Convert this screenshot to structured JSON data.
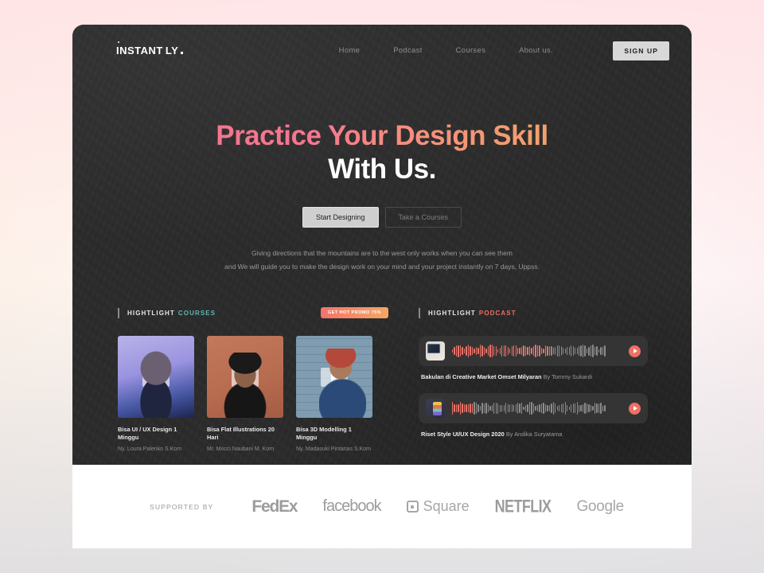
{
  "brand": {
    "name_main": "INSTANT",
    "name_sub": "LY",
    "punct": "."
  },
  "nav": {
    "links": [
      {
        "label": "Home"
      },
      {
        "label": "Podcast"
      },
      {
        "label": "Courses"
      },
      {
        "label": "About us."
      }
    ],
    "signup_label": "SIGN UP"
  },
  "hero": {
    "headline_line1": "Practice Your Design Skill",
    "headline_line2": "With Us.",
    "primary_cta": "Start Designing",
    "secondary_cta": "Take a Courses",
    "lede_line1": "Giving directions that the mountains are to the west only works when you can see them",
    "lede_line2": "and We will guide you to make the design work on your mind and your project instantly on 7 days, Uppss."
  },
  "courses": {
    "section_label": "HIGHTLIGHT",
    "section_accent": "COURSES",
    "section_accent_color": "#5fb8b0",
    "promo_badge": "GET HOT PROMO 75%",
    "items": [
      {
        "title": "Bisa UI / UX Design 1 Minggu",
        "author": "Ny. Loura Palenko S.Kom"
      },
      {
        "title": "Bisa Flat Illustrations 20 Hari",
        "author": "Mr. Mocci Naubani M. Kom"
      },
      {
        "title": "Bisa 3D Modelling 1 Minggu",
        "author": "Ny. Madasuki Pintarias S.Kom"
      }
    ]
  },
  "podcast": {
    "section_label": "HIGHTLIGHT",
    "section_accent": "PODCAST",
    "section_accent_color": "#ef6f63",
    "items": [
      {
        "title": "Bakulan di Creative Market Omset Milyaran",
        "author": "By Tommy Sukardi",
        "progress": 62
      },
      {
        "title": "Riset Style UI/UX Design 2020",
        "author": "By Andika Suryatama",
        "progress": 14
      }
    ]
  },
  "footer": {
    "supported_by": "SUPPORTED BY",
    "brands": [
      {
        "name": "FedEx"
      },
      {
        "name": "facebook"
      },
      {
        "name": "Square"
      },
      {
        "name": "NETFLIX"
      },
      {
        "name": "Google"
      }
    ]
  },
  "colors": {
    "accent_pink": "#f4768f",
    "accent_orange": "#f3a06b",
    "card_bg": "#2b2b2b"
  }
}
